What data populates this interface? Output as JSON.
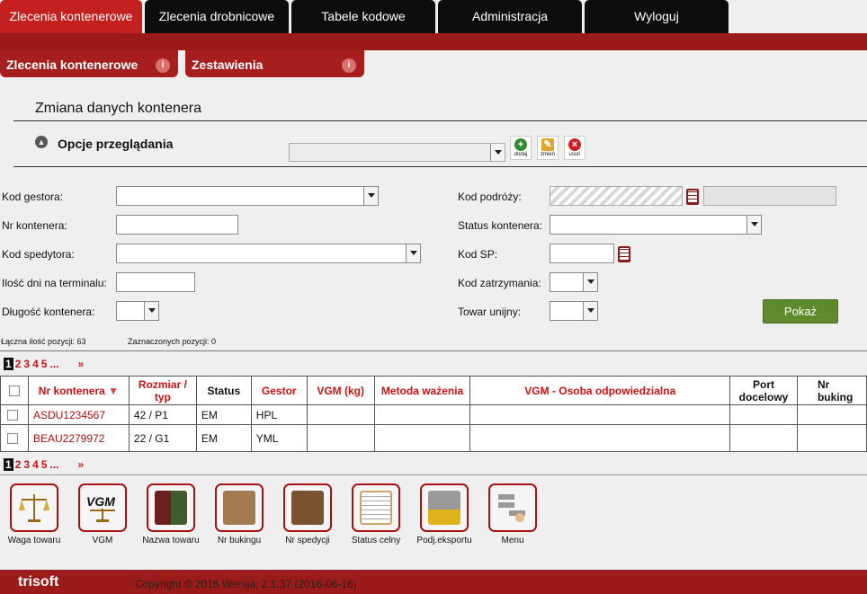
{
  "top_tabs": [
    "Zlecenia kontenerowe",
    "Zlecenia drobnicowe",
    "Tabele kodowe",
    "Administracja",
    "Wyloguj"
  ],
  "sub_tabs": [
    "Zlecenia kontenerowe",
    "Zestawienia"
  ],
  "page_title": "Zmiana danych kontenera",
  "options_label": "Opcje przeglądania",
  "toolbar": {
    "add": "dodaj",
    "edit": "zmień",
    "delete": "usuń"
  },
  "form": {
    "kod_gestora": "Kod gestora:",
    "nr_kontenera": "Nr kontenera:",
    "kod_spedytora": "Kod spedytora:",
    "ilosc_dni": "Ilość dni na terminalu:",
    "dlugosc": "Długość kontenera:",
    "kod_podrozy": "Kod podróży:",
    "status_kontenera": "Status kontenera:",
    "kod_sp": "Kod SP:",
    "kod_zatrzymania": "Kod zatrzymania:",
    "towar_unijny": "Towar unijny:",
    "show_button": "Pokaż"
  },
  "summary": {
    "total": "Łączna ilość pozycji: 63",
    "selected": "Zaznaczonych pozycji: 0"
  },
  "pager": {
    "current": "1",
    "pages": [
      "2",
      "3",
      "4",
      "5",
      "..."
    ],
    "next": "»"
  },
  "table": {
    "headers": [
      "Nr kontenera",
      "Rozmiar / typ",
      "Status",
      "Gestor",
      "VGM (kg)",
      "Metoda ważenia",
      "VGM - Osoba odpowiedzialna",
      "Port docelowy",
      "Nr buking"
    ],
    "rows": [
      [
        "ASDU1234567",
        "42 / P1",
        "EM",
        "HPL",
        "",
        "",
        "",
        "",
        ""
      ],
      [
        "BEAU2279972",
        "22 / G1",
        "EM",
        "YML",
        "",
        "",
        "",
        "",
        ""
      ]
    ]
  },
  "tools": [
    "Waga towaru",
    "VGM",
    "Nazwa towaru",
    "Nr bukingu",
    "Nr spedycji",
    "Status celny",
    "Podj.eksportu",
    "Menu"
  ],
  "tool_icon_text": {
    "vgm": "VGM"
  },
  "footer": {
    "logo": "trisoft",
    "text": "Copyright © 2016    Wersja: 2.1.37 (2016-06-16)"
  },
  "colors": {
    "brand_red": "#9b1b1b",
    "active_tab": "#c4201f",
    "show_button": "#5f8a2c"
  }
}
